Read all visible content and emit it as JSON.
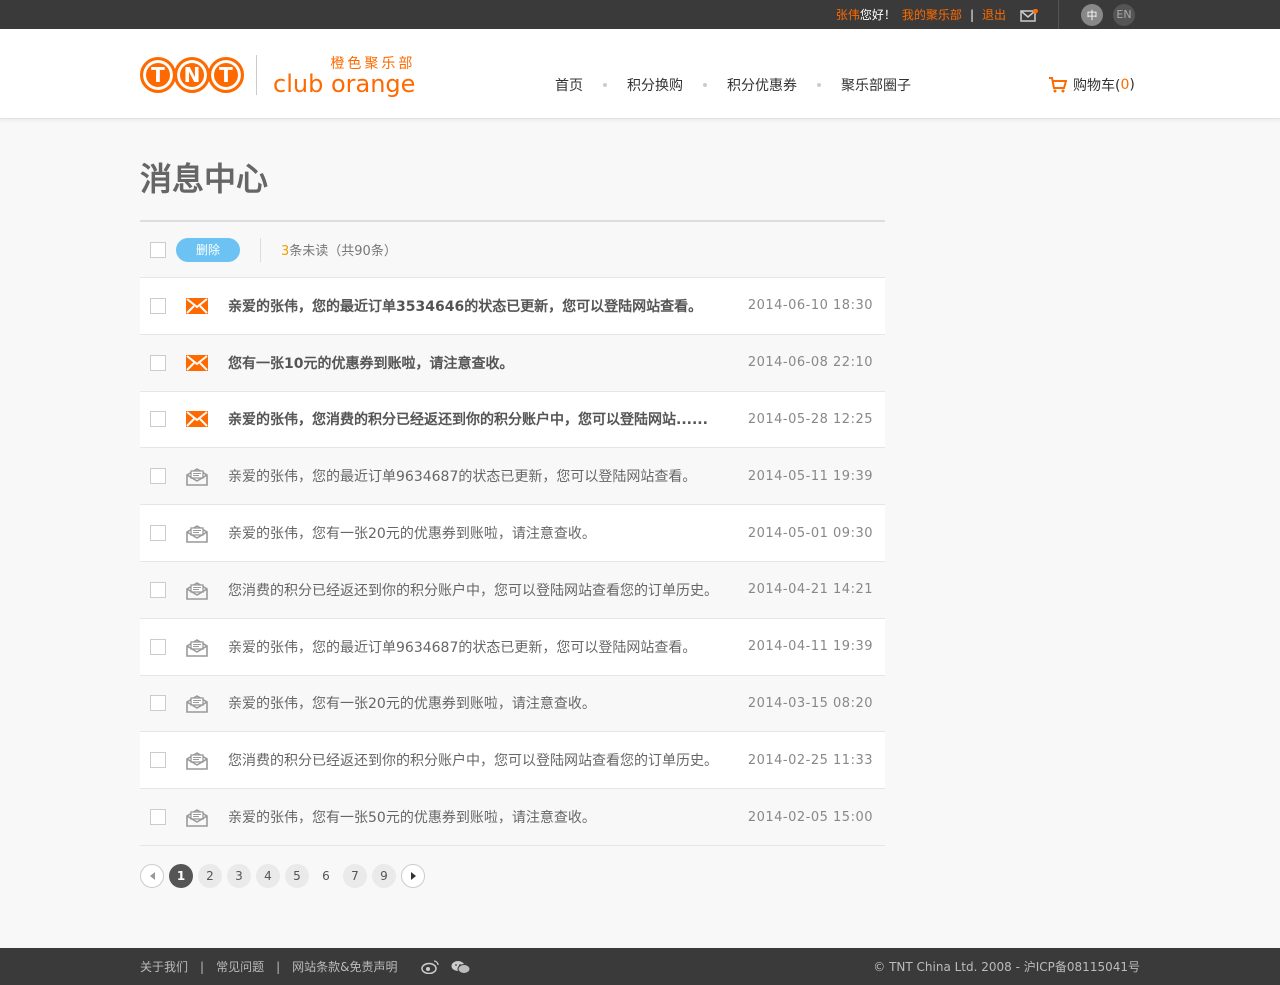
{
  "topbar": {
    "user_name": "张伟",
    "greeting": "您好！",
    "my_club": "我的聚乐部",
    "separator": "|",
    "logout": "退出",
    "lang_cn": "中",
    "lang_en": "EN"
  },
  "logo": {
    "tnt": [
      "T",
      "N",
      "T"
    ],
    "club_cn": "橙色聚乐部",
    "club_en": "club orange"
  },
  "nav": {
    "items": [
      "首页",
      "积分换购",
      "积分优惠券",
      "聚乐部圈子"
    ]
  },
  "cart": {
    "label": "购物车(",
    "count": "0",
    "close": ")"
  },
  "page_title": "消息中心",
  "toolbar": {
    "delete_label": "删除",
    "unread_count": "3",
    "unread_text": "条未读（共90条）"
  },
  "messages": [
    {
      "text": "亲爱的张伟，您的最近订单3534646的状态已更新，您可以登陆网站查看。",
      "time": "2014-06-10 18:30",
      "unread": true
    },
    {
      "text": "您有一张10元的优惠券到账啦，请注意查收。",
      "time": "2014-06-08 22:10",
      "unread": true
    },
    {
      "text": "亲爱的张伟，您消费的积分已经返还到你的积分账户中，您可以登陆网站......",
      "time": "2014-05-28 12:25",
      "unread": true
    },
    {
      "text": "亲爱的张伟，您的最近订单9634687的状态已更新，您可以登陆网站查看。",
      "time": "2014-05-11 19:39",
      "unread": false
    },
    {
      "text": "亲爱的张伟，您有一张20元的优惠券到账啦，请注意查收。",
      "time": "2014-05-01 09:30",
      "unread": false
    },
    {
      "text": "您消费的积分已经返还到你的积分账户中，您可以登陆网站查看您的订单历史。",
      "time": "2014-04-21 14:21",
      "unread": false
    },
    {
      "text": "亲爱的张伟，您的最近订单9634687的状态已更新，您可以登陆网站查看。",
      "time": "2014-04-11 19:39",
      "unread": false
    },
    {
      "text": "亲爱的张伟，您有一张20元的优惠券到账啦，请注意查收。",
      "time": "2014-03-15 08:20",
      "unread": false
    },
    {
      "text": "您消费的积分已经返还到你的积分账户中，您可以登陆网站查看您的订单历史。",
      "time": "2014-02-25 11:33",
      "unread": false
    },
    {
      "text": "亲爱的张伟，您有一张50元的优惠券到账啦，请注意查收。",
      "time": "2014-02-05 15:00",
      "unread": false
    }
  ],
  "pagination": {
    "pages": [
      {
        "label": "1",
        "style": "active"
      },
      {
        "label": "2",
        "style": "normal"
      },
      {
        "label": "3",
        "style": "normal"
      },
      {
        "label": "4",
        "style": "normal"
      },
      {
        "label": "5",
        "style": "normal"
      },
      {
        "label": "6",
        "style": "plain"
      },
      {
        "label": "7",
        "style": "normal"
      },
      {
        "label": "9",
        "style": "normal"
      }
    ]
  },
  "footer": {
    "links": [
      "关于我们",
      "常见问题",
      "网站条款&免责声明"
    ],
    "separator": "|",
    "copyright": "© TNT China Ltd. 2008 - 沪ICP备08115041号"
  },
  "colors": {
    "accent": "#ff6a00",
    "button_blue": "#6cc2f2",
    "dark_bar": "#3a3a3a",
    "unread_count": "#f0a000"
  },
  "icons": {
    "unread_message": "mail-unread-icon",
    "read_message": "mail-read-icon",
    "cart": "cart-icon",
    "notify": "mail-notify-icon",
    "weibo": "weibo-icon",
    "wechat": "wechat-icon"
  }
}
